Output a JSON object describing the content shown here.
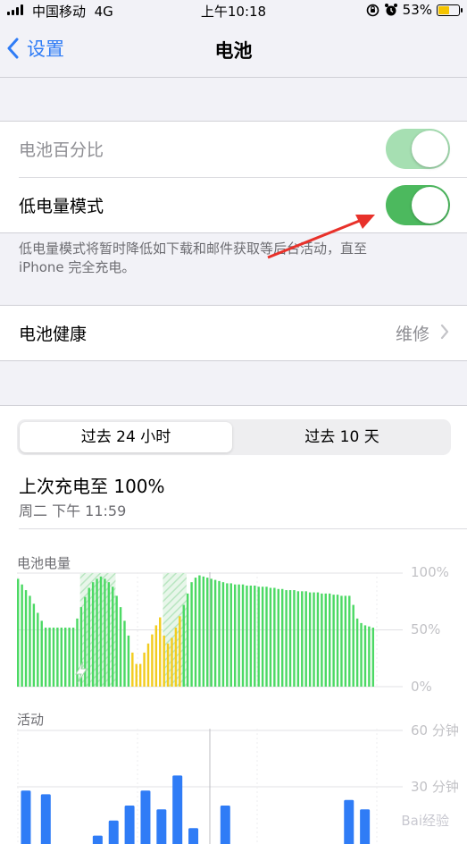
{
  "status_bar": {
    "carrier": "中国移动",
    "network": "4G",
    "time": "上午10:18",
    "battery_percent": "53%",
    "battery_level": 0.53
  },
  "nav": {
    "back_label": "设置",
    "title": "电池"
  },
  "settings": {
    "battery_percentage_label": "电池百分比",
    "battery_percentage_on": true,
    "low_power_label": "低电量模式",
    "low_power_on": true,
    "low_power_note_line1": "低电量模式将暂时降低如下载和邮件获取等后台活动，直至",
    "low_power_note_line2": "iPhone 完全充电。",
    "battery_health_label": "电池健康",
    "battery_health_value": "维修"
  },
  "usage": {
    "tabs": [
      "过去 24 小时",
      "过去 10 天"
    ],
    "selected_tab": 0,
    "last_charge_label": "上次充电至 100%",
    "last_charge_time": "周二 下午 11:59"
  },
  "chart_data": [
    {
      "type": "bar",
      "title": "电池电量",
      "ylabels": [
        "100%",
        "50%",
        "0%"
      ],
      "ylim": [
        0,
        100
      ],
      "grid": true,
      "values": [
        95,
        90,
        85,
        80,
        73,
        65,
        58,
        52,
        52,
        52,
        52,
        52,
        52,
        52,
        52,
        60,
        70,
        79,
        87,
        92,
        95,
        97,
        95,
        92,
        88,
        80,
        70,
        58,
        45,
        30,
        20,
        20,
        30,
        38,
        46,
        54,
        61,
        45,
        38,
        43,
        52,
        62,
        72,
        82,
        92,
        96,
        98,
        97,
        96,
        95,
        94,
        93,
        92,
        91,
        91,
        90,
        90,
        90,
        89,
        89,
        89,
        88,
        88,
        88,
        87,
        87,
        86,
        86,
        85,
        85,
        85,
        84,
        84,
        84,
        83,
        83,
        83,
        82,
        82,
        82,
        81,
        81,
        80,
        80,
        80,
        72,
        60,
        56,
        54,
        53,
        52
      ],
      "colors": [
        "#4cd964",
        "#f2cc1f"
      ],
      "yellow_ranges": [
        [
          29,
          41
        ]
      ],
      "charging_ranges": [
        [
          16,
          24
        ],
        [
          37,
          42
        ]
      ]
    },
    {
      "type": "bar",
      "title": "活动",
      "ylabels": [
        "60 分钟",
        "30 分钟"
      ],
      "ylim": [
        0,
        60
      ],
      "grid": true,
      "x": [
        1,
        6,
        19,
        23,
        27,
        31,
        35,
        39,
        43,
        51,
        82,
        86
      ],
      "values": [
        28,
        26,
        4,
        12,
        20,
        28,
        18,
        36,
        8,
        20,
        23,
        18
      ],
      "color": "#2f7cf6"
    }
  ],
  "watermark": "Bai经验"
}
